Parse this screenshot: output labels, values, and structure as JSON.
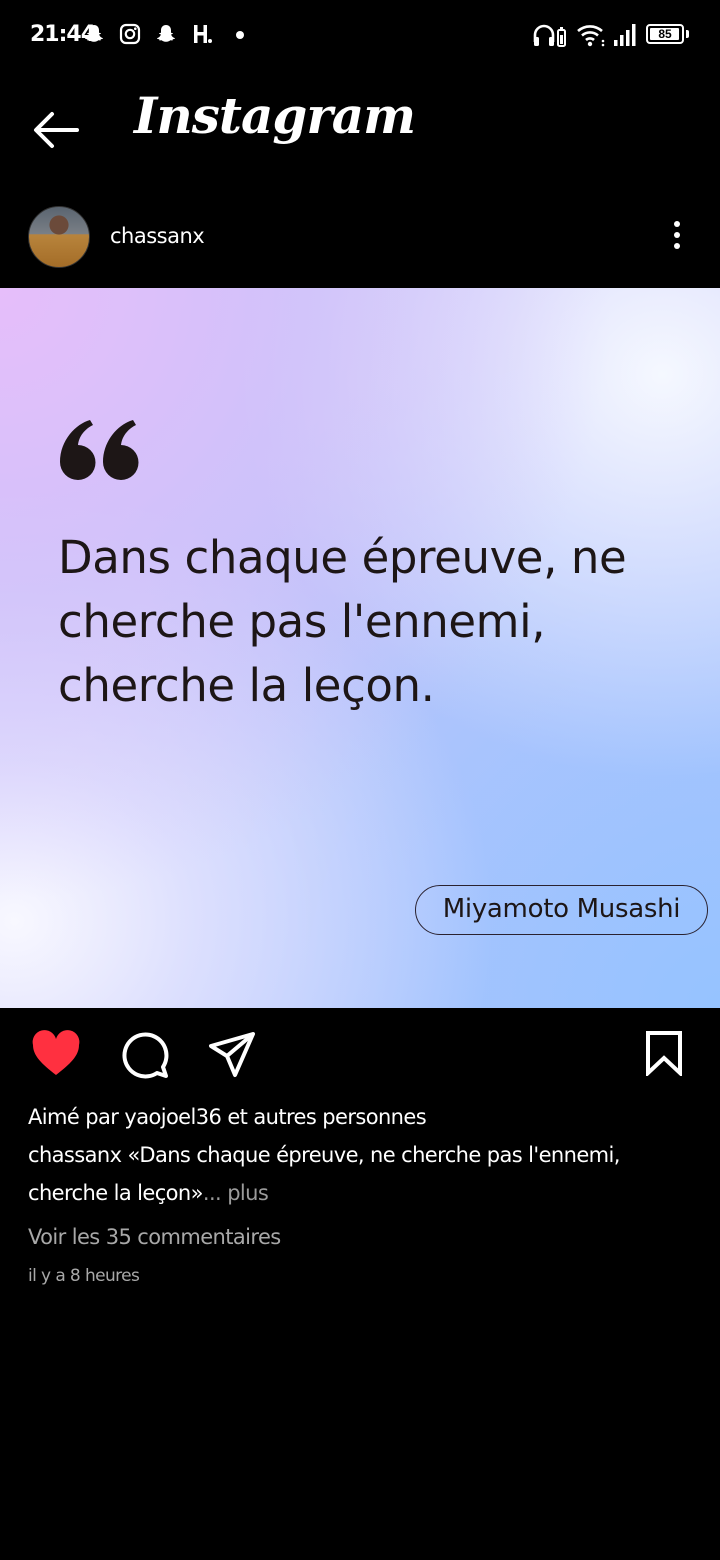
{
  "status_bar": {
    "time": "21:44",
    "battery": "85",
    "notification_icons": [
      "snapchat-icon",
      "instagram-icon",
      "snapchat-icon",
      "h-app-icon",
      "dot-icon"
    ],
    "system_icons": [
      "headphones-icon",
      "wifi-icon",
      "signal-icon",
      "battery-icon"
    ]
  },
  "header": {
    "title": "Instagram",
    "back_icon": "arrow-left-icon"
  },
  "post": {
    "username": "chassanx",
    "quote": "Dans chaque épreuve, ne cherche pas l'ennemi, cherche la leçon.",
    "author": "Miyamoto Musashi",
    "liked": true,
    "like_color": "#ff3040",
    "likes_text": "Aimé par yaojoel36 et autres personnes",
    "caption_user": "chassanx",
    "caption_text": " «Dans chaque épreuve, ne cherche pas l'ennemi, cherche la leçon»",
    "more_label": "... plus",
    "comments_label": "Voir les 35 commentaires",
    "timestamp": "il y a 8 heures"
  },
  "actions": [
    "heart-icon",
    "comment-icon",
    "share-icon",
    "bookmark-icon"
  ]
}
